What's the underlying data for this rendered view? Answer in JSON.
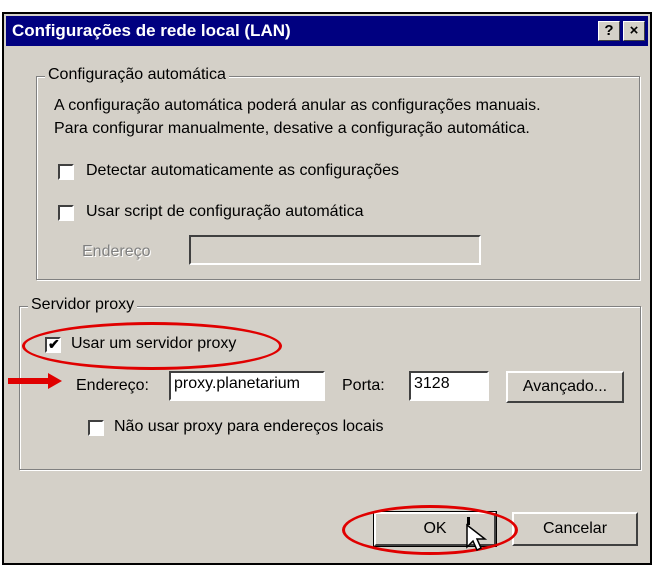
{
  "window": {
    "title": "Configurações de rede local (LAN)",
    "help_label": "?",
    "close_label": "×"
  },
  "auto_config": {
    "legend": "Configuração automática",
    "description_line1": "A configuração automática poderá anular as configurações manuais.",
    "description_line2": "Para configurar manualmente, desative a configuração automática.",
    "detect_label": "Detectar automaticamente as configurações",
    "detect_checked": false,
    "script_label": "Usar script de configuração automática",
    "script_checked": false,
    "address_label": "Endereço",
    "address_value": ""
  },
  "proxy": {
    "legend": "Servidor proxy",
    "use_proxy_label": "Usar um servidor proxy",
    "use_proxy_checked": true,
    "address_label": "Endereço:",
    "address_value": "proxy.planetarium",
    "port_label": "Porta:",
    "port_value": "3128",
    "advanced_label": "Avançado...",
    "bypass_label": "Não usar proxy para endereços locais",
    "bypass_checked": false
  },
  "buttons": {
    "ok_label": "OK",
    "cancel_label": "Cancelar"
  },
  "colors": {
    "titlebar": "#000080",
    "face": "#d4d0c8",
    "highlight_red": "#e00000"
  }
}
